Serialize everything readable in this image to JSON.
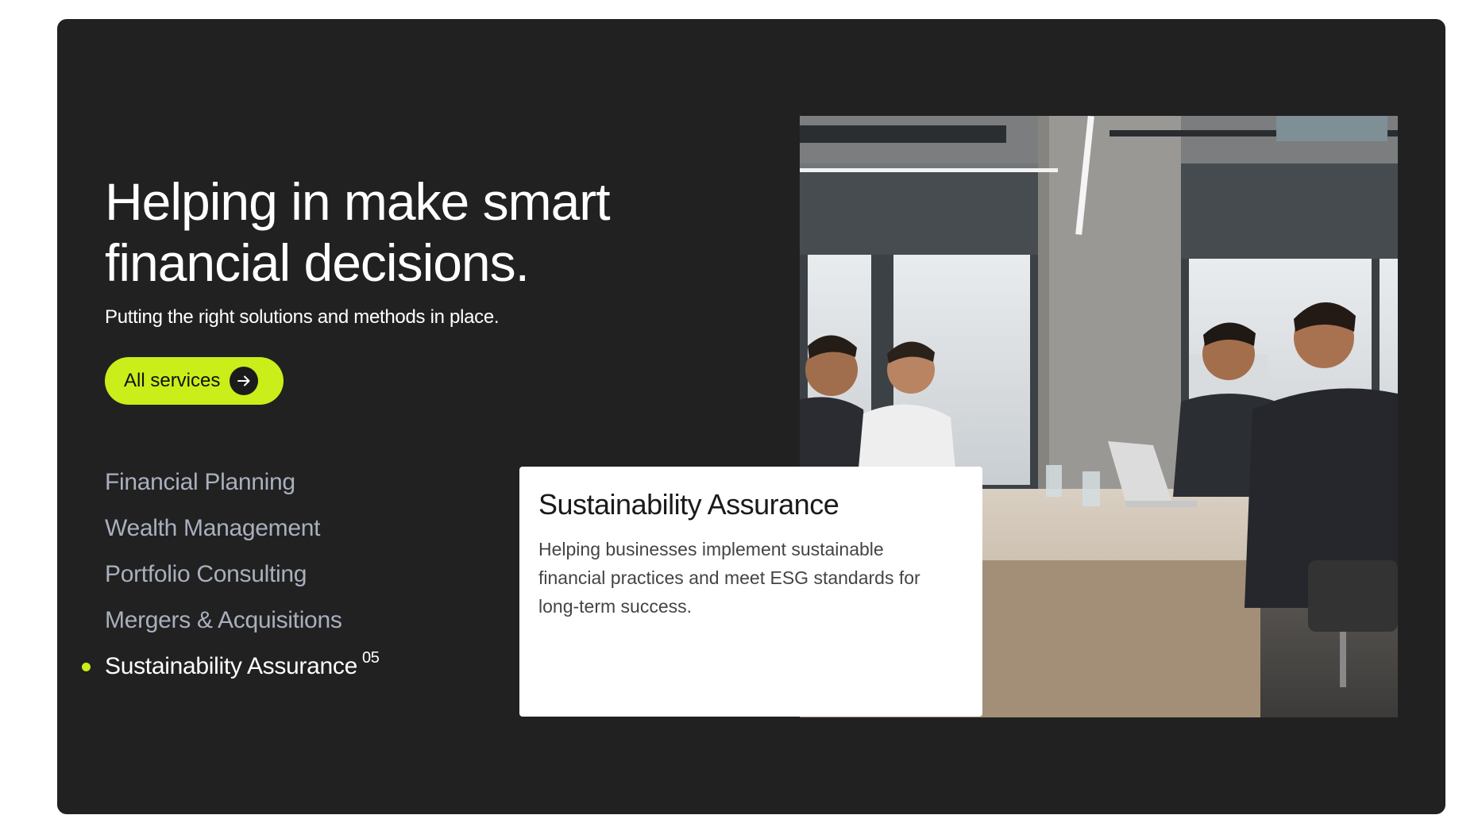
{
  "hero": {
    "headline": "Helping in make smart\nfinancial decisions.",
    "subline": "Putting the right solutions and methods in place."
  },
  "cta": {
    "label": "All services",
    "icon": "arrow-right-icon"
  },
  "services": [
    {
      "label": "Financial Planning",
      "active": false
    },
    {
      "label": "Wealth Management",
      "active": false
    },
    {
      "label": "Portfolio Consulting",
      "active": false
    },
    {
      "label": "Mergers & Acquisitions",
      "active": false
    },
    {
      "label": "Sustainability Assurance",
      "active": true,
      "number": "05"
    }
  ],
  "card": {
    "title": "Sustainability Assurance",
    "text": "Helping businesses implement sustainable financial practices and meet ESG standards for long-term success."
  },
  "colors": {
    "panel": "#212121",
    "accent": "#c9ee1a",
    "inactive_text": "#a9afbd",
    "active_text": "#ffffff"
  }
}
